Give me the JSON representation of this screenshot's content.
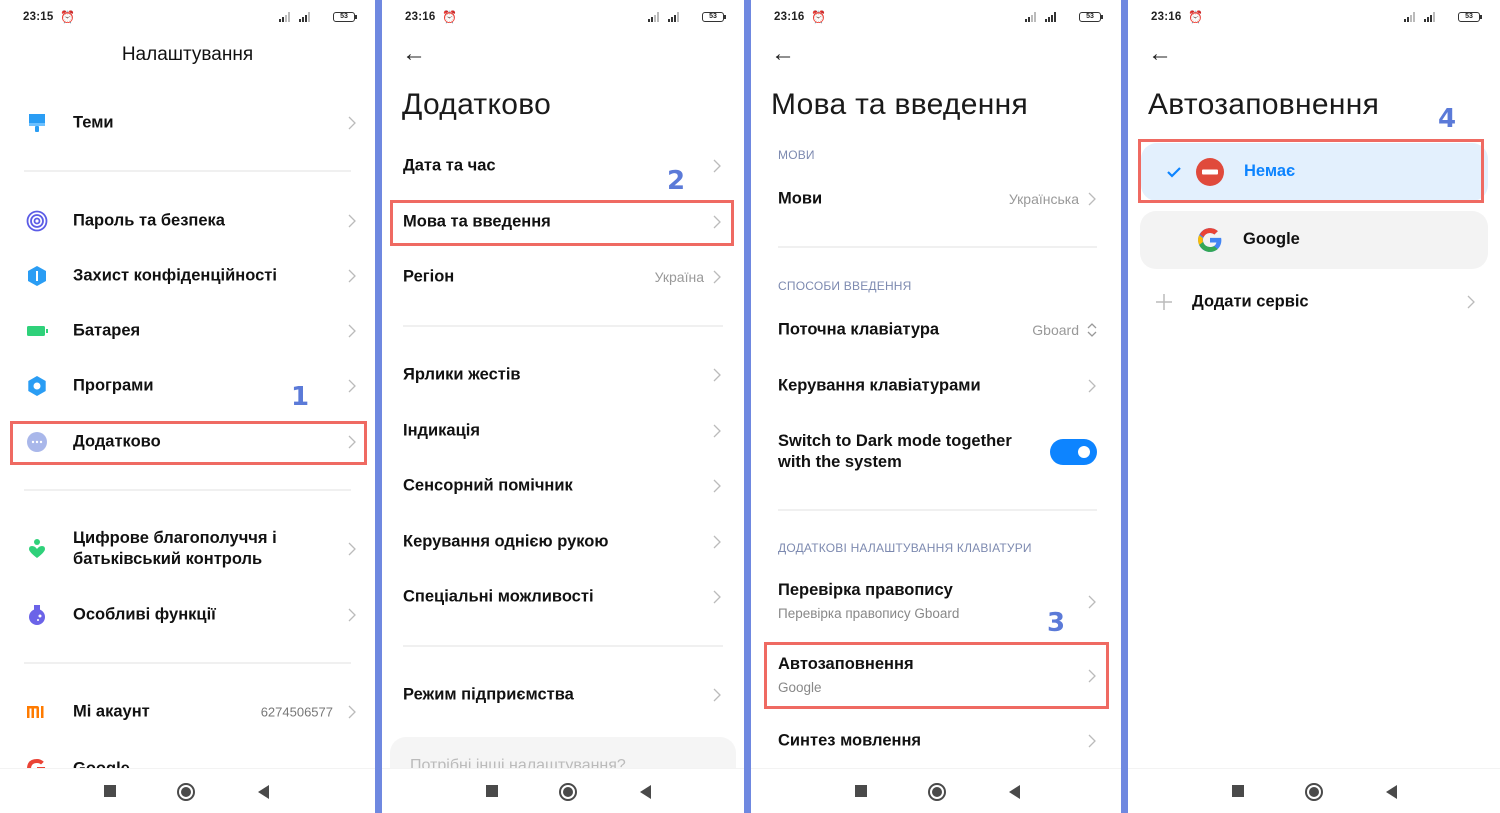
{
  "colors": {
    "separator": "#6f88e0",
    "highlight": "#ef6a62",
    "step_number": "#5b7ad8",
    "accent_blue": "#0d84ff",
    "selected_bg": "#e3f0fd",
    "section_label": "#7d8ab0"
  },
  "panels": [
    {
      "status": {
        "time": "23:15",
        "battery": "53"
      },
      "title": "Налаштування",
      "items": [
        {
          "label": "Теми",
          "icon": "paintbrush-icon"
        },
        {
          "label": "Пароль та безпека",
          "icon": "fingerprint-icon"
        },
        {
          "label": "Захист конфіденційності",
          "icon": "privacy-shield-icon"
        },
        {
          "label": "Батарея",
          "icon": "battery-icon"
        },
        {
          "label": "Програми",
          "icon": "gear-icon"
        },
        {
          "label": "Додатково",
          "icon": "more-dots-icon"
        },
        {
          "label": "Цифрове благополуччя і батьківський контроль",
          "icon": "wellbeing-icon"
        },
        {
          "label": "Особливі функції",
          "icon": "flask-icon"
        },
        {
          "label": "Mi акаунт",
          "icon": "mi-logo-icon",
          "value": "6274506577"
        },
        {
          "label": "Google",
          "icon": "google-icon"
        }
      ],
      "step": "1"
    },
    {
      "status": {
        "time": "23:16",
        "battery": "53"
      },
      "title": "Додатково",
      "items": [
        {
          "label": "Дата та час"
        },
        {
          "label": "Мова та введення"
        },
        {
          "label": "Регіон",
          "value": "Україна"
        },
        {
          "label": "Ярлики жестів"
        },
        {
          "label": "Індикація"
        },
        {
          "label": "Сенсорний помічник"
        },
        {
          "label": "Керування однією рукою"
        },
        {
          "label": "Спеціальні можливості"
        },
        {
          "label": "Режим підприємства"
        }
      ],
      "more_settings": "Потрібні інші налаштування?",
      "step": "2"
    },
    {
      "status": {
        "time": "23:16",
        "battery": "53"
      },
      "title": "Мова та введення",
      "sections": {
        "languages": "МОВИ",
        "input_methods": "СПОСОБИ ВВЕДЕННЯ",
        "keyboard_extra": "ДОДАТКОВІ НАЛАШТУВАННЯ КЛАВІАТУРИ"
      },
      "items": [
        {
          "label": "Мови",
          "value": "Українська"
        },
        {
          "label": "Поточна клавіатура",
          "value": "Gboard"
        },
        {
          "label": "Керування клавіатурами"
        },
        {
          "label": "Switch to Dark mode together with the system",
          "toggle": true
        },
        {
          "label": "Перевірка правопису",
          "sub": "Перевірка правопису Gboard"
        },
        {
          "label": "Автозаповнення",
          "sub": "Google"
        },
        {
          "label": "Синтез мовлення"
        }
      ],
      "step": "3"
    },
    {
      "status": {
        "time": "23:16",
        "battery": "53"
      },
      "title": "Автозаповнення",
      "options": [
        {
          "label": "Немає",
          "selected": true
        },
        {
          "label": "Google",
          "selected": false
        }
      ],
      "add_service": "Додати сервіс",
      "step": "4"
    }
  ]
}
